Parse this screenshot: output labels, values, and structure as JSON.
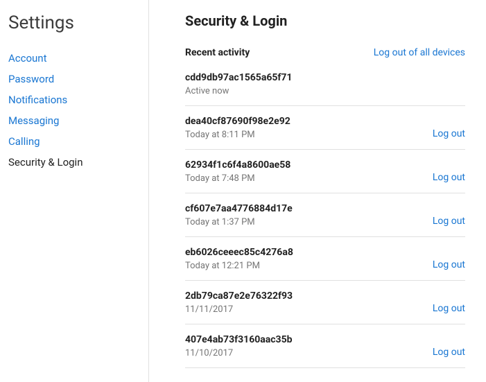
{
  "sidebar": {
    "title": "Settings",
    "items": [
      {
        "label": "Account",
        "active": false
      },
      {
        "label": "Password",
        "active": false
      },
      {
        "label": "Notifications",
        "active": false
      },
      {
        "label": "Messaging",
        "active": false
      },
      {
        "label": "Calling",
        "active": false
      },
      {
        "label": "Security & Login",
        "active": true
      }
    ]
  },
  "main": {
    "title": "Security & Login",
    "section_label": "Recent activity",
    "logout_all_label": "Log out of all devices",
    "logout_label": "Log out",
    "sessions": [
      {
        "id": "cdd9db97ac1565a65f71",
        "status": "Active now",
        "can_logout": false
      },
      {
        "id": "dea40cf87690f98e2e92",
        "status": "Today at 8:11 PM",
        "can_logout": true
      },
      {
        "id": "62934f1c6f4a8600ae58",
        "status": "Today at 7:48 PM",
        "can_logout": true
      },
      {
        "id": "cf607e7aa4776884d17e",
        "status": "Today at 1:37 PM",
        "can_logout": true
      },
      {
        "id": "eb6026ceeec85c4276a8",
        "status": "Today at 12:21 PM",
        "can_logout": true
      },
      {
        "id": "2db79ca87e2e76322f93",
        "status": "11/11/2017",
        "can_logout": true
      },
      {
        "id": "407e4ab73f3160aac35b",
        "status": "11/10/2017",
        "can_logout": true
      }
    ]
  }
}
